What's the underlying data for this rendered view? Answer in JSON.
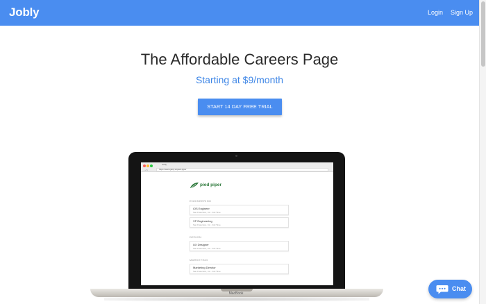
{
  "navbar": {
    "logo": "Jobly",
    "login": "Login",
    "signup": "Sign Up",
    "color": "#4a8df0"
  },
  "hero": {
    "title": "The Affordable Careers Page",
    "subtitle": "Starting at $9/month",
    "cta": "START 14 DAY FREE TRIAL"
  },
  "laptop": {
    "brand": "MacBook",
    "browser": {
      "tab_title": "Jobly",
      "url": "https://www.jobly.io/pied-piper"
    },
    "careers": {
      "company": "pied piper",
      "sections": [
        {
          "title": "ENGINEERING",
          "jobs": [
            {
              "title": "iOS Engineer",
              "meta": "San Francisco, CA · Full Time"
            },
            {
              "title": "VP Engineering",
              "meta": "San Francisco, CA · Full Time"
            }
          ]
        },
        {
          "title": "DESIGN",
          "jobs": [
            {
              "title": "UX Designer",
              "meta": "San Francisco, CA · Full Time"
            }
          ]
        },
        {
          "title": "MARKETING",
          "jobs": [
            {
              "title": "Marketing Director",
              "meta": "San Francisco, CA · Full Time"
            }
          ]
        }
      ]
    }
  },
  "chat": {
    "label": "Chat",
    "icon": "chat-bubble-icon"
  },
  "colors": {
    "accent": "#4a8df0",
    "subtitle": "#3e86e6",
    "brand_green": "#2f7a3d"
  }
}
